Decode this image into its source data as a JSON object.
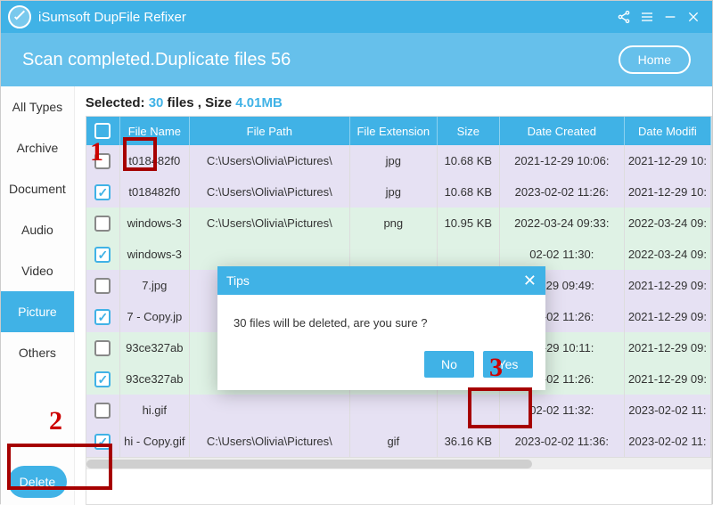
{
  "app": {
    "title": "iSumsoft DupFile Refixer"
  },
  "window_controls": {
    "share": "⟪",
    "menu": "≡",
    "min": "—",
    "close": "✕"
  },
  "status": {
    "message": "Scan completed.Duplicate files 56",
    "home": "Home"
  },
  "summary": {
    "label_selected": "Selected:",
    "count": "30",
    "files_word": "files ,",
    "size_word": "Size",
    "size": "4.01MB"
  },
  "sidebar": {
    "categories": [
      "All Types",
      "Archive",
      "Document",
      "Audio",
      "Video",
      "Picture",
      "Others"
    ],
    "active_index": 5,
    "delete": "Delete"
  },
  "columns": {
    "name": "File Name",
    "path": "File Path",
    "ext": "File Extension",
    "size": "Size",
    "created": "Date Created",
    "modified": "Date Modifi"
  },
  "rows": [
    {
      "checked": false,
      "g": 0,
      "name": "t018482f0",
      "path": "C:\\Users\\Olivia\\Pictures\\",
      "ext": "jpg",
      "size": "10.68 KB",
      "created": "2021-12-29 10:06:",
      "modified": "2021-12-29 10:"
    },
    {
      "checked": true,
      "g": 0,
      "name": "t018482f0",
      "path": "C:\\Users\\Olivia\\Pictures\\",
      "ext": "jpg",
      "size": "10.68 KB",
      "created": "2023-02-02 11:26:",
      "modified": "2021-12-29 10:"
    },
    {
      "checked": false,
      "g": 1,
      "name": "windows-3",
      "path": "C:\\Users\\Olivia\\Pictures\\",
      "ext": "png",
      "size": "10.95 KB",
      "created": "2022-03-24 09:33:",
      "modified": "2022-03-24 09:"
    },
    {
      "checked": true,
      "g": 1,
      "name": "windows-3",
      "path": "",
      "ext": "",
      "size": "",
      "created": "02-02 11:30:",
      "modified": "2022-03-24 09:"
    },
    {
      "checked": false,
      "g": 0,
      "name": "7.jpg",
      "path": "",
      "ext": "",
      "size": "",
      "created": "12-29 09:49:",
      "modified": "2021-12-29 09:"
    },
    {
      "checked": true,
      "g": 0,
      "name": "7 - Copy.jp",
      "path": "",
      "ext": "",
      "size": "",
      "created": "02-02 11:26:",
      "modified": "2021-12-29 09:"
    },
    {
      "checked": false,
      "g": 1,
      "name": "93ce327ab",
      "path": "",
      "ext": "",
      "size": "",
      "created": "12-29 10:11:",
      "modified": "2021-12-29 09:"
    },
    {
      "checked": true,
      "g": 1,
      "name": "93ce327ab",
      "path": "",
      "ext": "",
      "size": "",
      "created": "02-02 11:26:",
      "modified": "2021-12-29 09:"
    },
    {
      "checked": false,
      "g": 0,
      "name": "hi.gif",
      "path": "",
      "ext": "",
      "size": "",
      "created": "02-02 11:32:",
      "modified": "2023-02-02 11:"
    },
    {
      "checked": true,
      "g": 0,
      "name": "hi - Copy.gif",
      "path": "C:\\Users\\Olivia\\Pictures\\",
      "ext": "gif",
      "size": "36.16 KB",
      "created": "2023-02-02 11:36:",
      "modified": "2023-02-02 11:"
    }
  ],
  "dialog": {
    "title": "Tips",
    "body": "30 files will be deleted, are you sure ?",
    "no": "No",
    "yes": "Yes"
  },
  "annotations": {
    "one": "1",
    "two": "2",
    "three": "3"
  }
}
